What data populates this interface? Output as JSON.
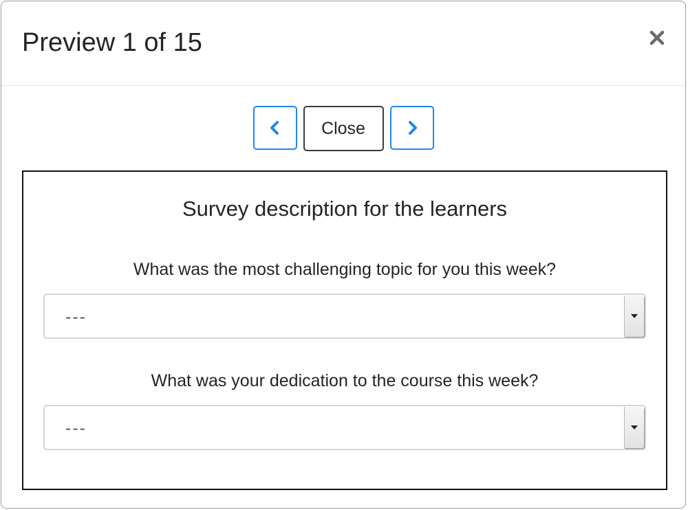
{
  "modal": {
    "title": "Preview 1 of 15",
    "close_icon": "close-x-icon"
  },
  "nav": {
    "prev_icon": "chevron-left-icon",
    "close_label": "Close",
    "next_icon": "chevron-right-icon",
    "accent": "#1e87f0"
  },
  "survey": {
    "description": "Survey description for the learners",
    "questions": [
      {
        "label": "What was the most challenging topic for you this week?",
        "value": "---"
      },
      {
        "label": "What was your dedication to the course this week?",
        "value": "---"
      }
    ]
  }
}
